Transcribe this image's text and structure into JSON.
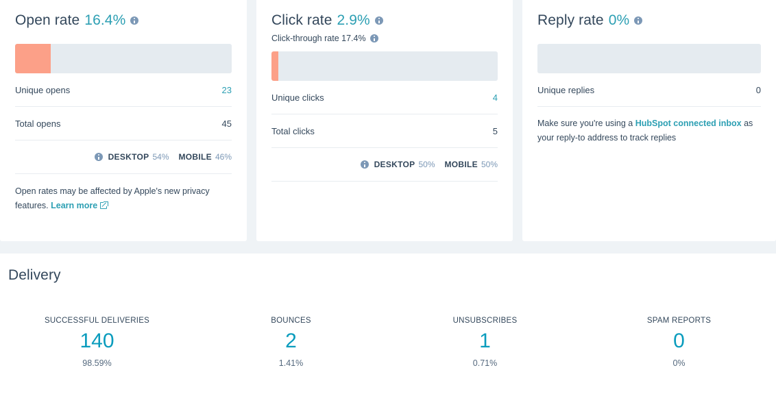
{
  "colors": {
    "accent_teal": "#2c9fb3",
    "stat_teal": "#0a9cbd",
    "bar_fill": "#fca088",
    "bar_track": "#e5ebf0",
    "heading": "#33475b",
    "page_bg": "#eff3f6"
  },
  "cards": [
    {
      "title": "Open rate",
      "rate": "16.4%",
      "info_icon": "info-icon",
      "bar": {
        "fill_percent": 16.4
      },
      "rows": [
        {
          "label": "Unique opens",
          "value": "23",
          "accent": true
        },
        {
          "label": "Total opens",
          "value": "45",
          "accent": false
        }
      ],
      "devices": {
        "info_icon": "info-icon",
        "desktop_label": "DESKTOP",
        "desktop_value": "54%",
        "mobile_label": "MOBILE",
        "mobile_value": "46%"
      },
      "note": {
        "text": "Open rates may be affected by Apple's new privacy features.",
        "link": "Learn more",
        "link_icon": "external-link-icon"
      }
    },
    {
      "title": "Click rate",
      "rate": "2.9%",
      "info_icon": "info-icon",
      "subtitle": "Click-through rate 17.4%",
      "subtitle_info_icon": "info-icon",
      "bar": {
        "fill_percent": 2.9
      },
      "rows": [
        {
          "label": "Unique clicks",
          "value": "4",
          "accent": true
        },
        {
          "label": "Total clicks",
          "value": "5",
          "accent": false
        }
      ],
      "devices": {
        "info_icon": "info-icon",
        "desktop_label": "DESKTOP",
        "desktop_value": "50%",
        "mobile_label": "MOBILE",
        "mobile_value": "50%"
      }
    },
    {
      "title": "Reply rate",
      "rate": "0%",
      "info_icon": "info-icon",
      "bar": {
        "fill_percent": 0
      },
      "rows": [
        {
          "label": "Unique replies",
          "value": "0",
          "accent": false
        }
      ],
      "note": {
        "text_before": "Make sure you're using a ",
        "link": "HubSpot connected inbox",
        "text_after": " as your reply-to address to track replies"
      }
    }
  ],
  "delivery": {
    "title": "Delivery",
    "stats": [
      {
        "label": "SUCCESSFUL DELIVERIES",
        "value": "140",
        "percent": "98.59%"
      },
      {
        "label": "BOUNCES",
        "value": "2",
        "percent": "1.41%"
      },
      {
        "label": "UNSUBSCRIBES",
        "value": "1",
        "percent": "0.71%"
      },
      {
        "label": "SPAM REPORTS",
        "value": "0",
        "percent": "0%"
      }
    ]
  }
}
